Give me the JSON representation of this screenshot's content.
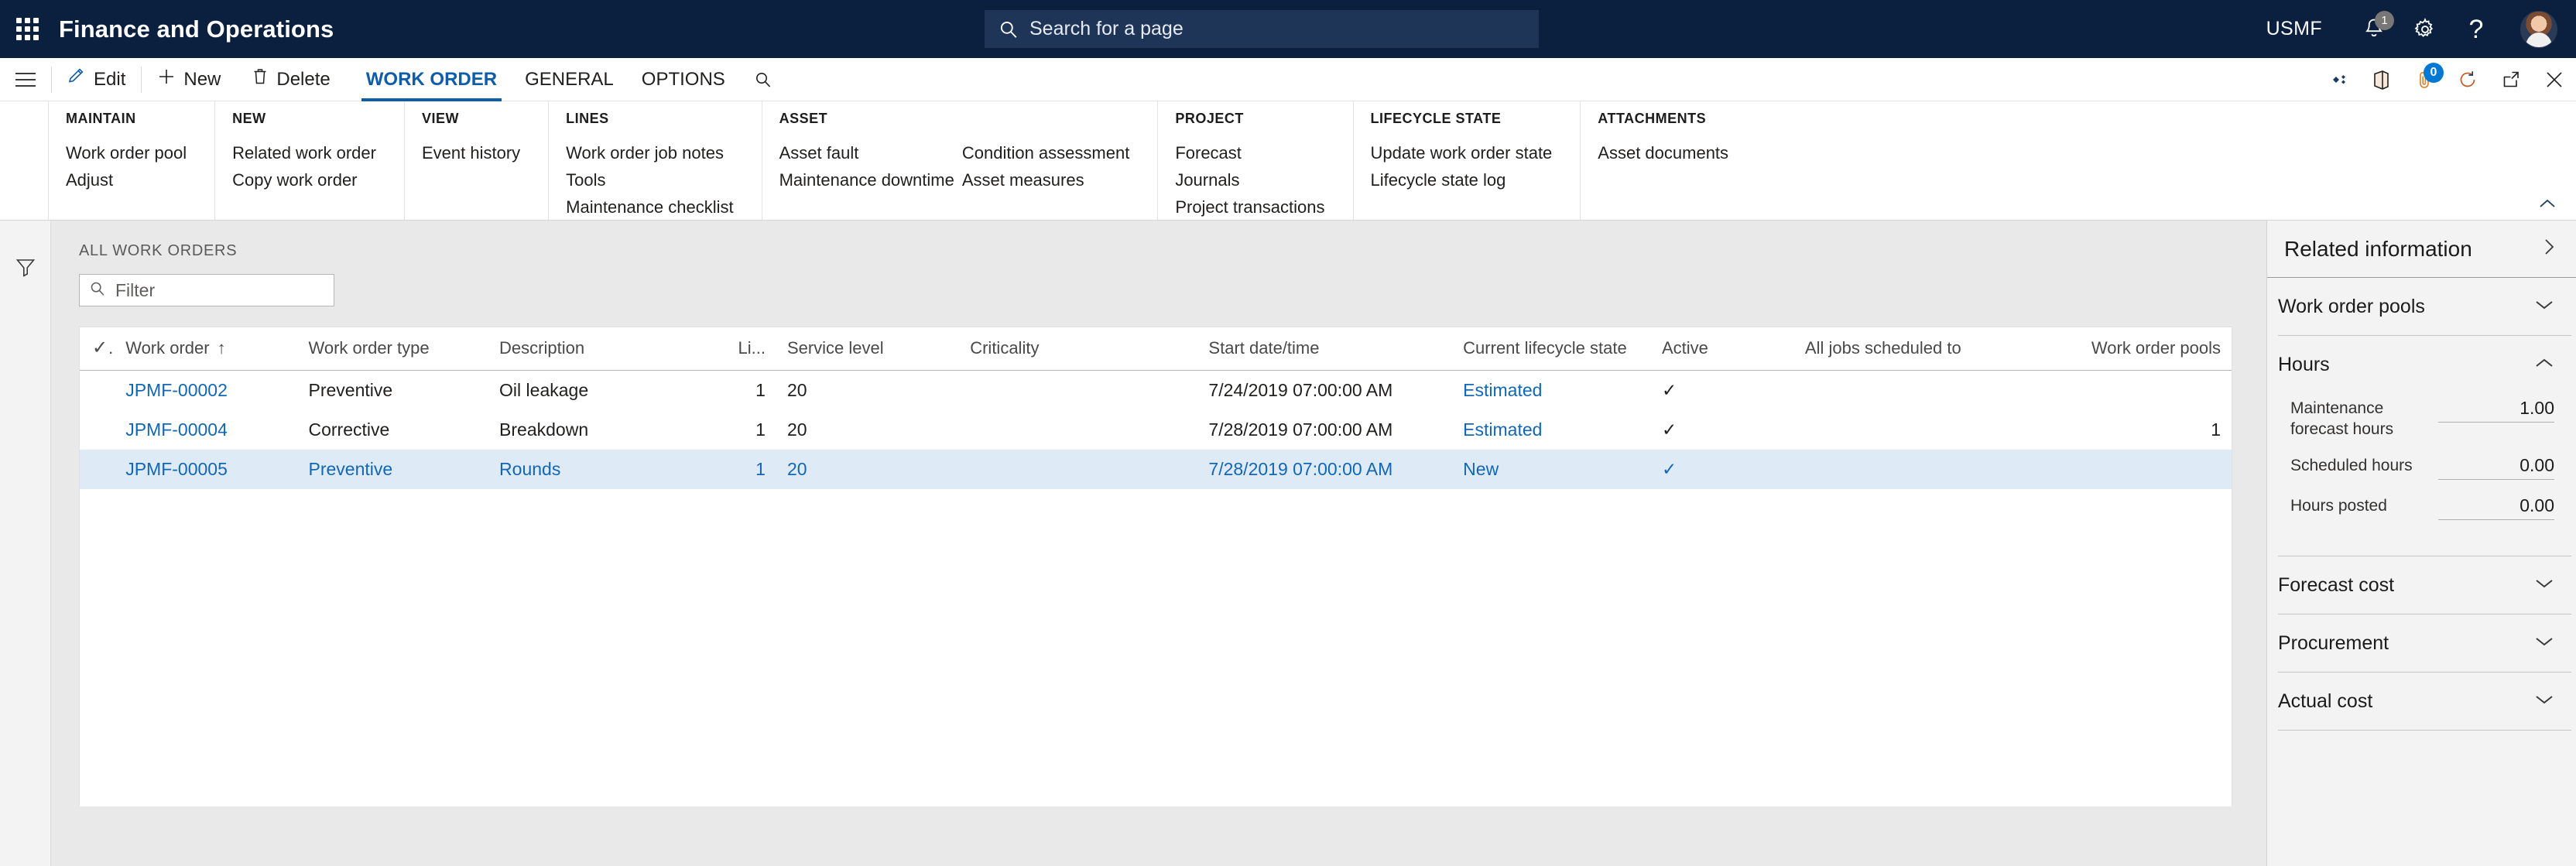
{
  "topbar": {
    "waffle_name": "app-launcher",
    "app_title": "Finance and Operations",
    "search_placeholder": "Search for a page",
    "company": "USMF",
    "notification_count": "1"
  },
  "commandbar": {
    "buttons": [
      {
        "label": "Edit",
        "icon": "pencil-icon"
      },
      {
        "label": "New",
        "icon": "plus-icon"
      },
      {
        "label": "Delete",
        "icon": "trash-icon"
      }
    ],
    "tabs": [
      {
        "label": "WORK ORDER",
        "active": true
      },
      {
        "label": "GENERAL",
        "active": false
      },
      {
        "label": "OPTIONS",
        "active": false
      }
    ],
    "attachment_count": "0"
  },
  "ribbon": {
    "groups": [
      {
        "title": "MAINTAIN",
        "columns": [
          {
            "items": [
              "Work order pool",
              "Adjust"
            ]
          }
        ]
      },
      {
        "title": "NEW",
        "columns": [
          {
            "items": [
              "Related work order",
              "Copy work order"
            ]
          }
        ]
      },
      {
        "title": "VIEW",
        "columns": [
          {
            "items": [
              "Event history"
            ]
          }
        ]
      },
      {
        "title": "LINES",
        "columns": [
          {
            "items": [
              "Work order job notes",
              "Tools",
              "Maintenance checklist"
            ]
          }
        ]
      },
      {
        "title": "ASSET",
        "columns": [
          {
            "items": [
              "Asset fault",
              "Maintenance downtime"
            ]
          },
          {
            "items": [
              "Condition assessment",
              "Asset measures"
            ]
          }
        ]
      },
      {
        "title": "PROJECT",
        "columns": [
          {
            "items": [
              "Forecast",
              "Journals",
              "Project transactions"
            ]
          }
        ]
      },
      {
        "title": "LIFECYCLE STATE",
        "columns": [
          {
            "items": [
              "Update work order state",
              "Lifecycle state log"
            ]
          }
        ]
      },
      {
        "title": "ATTACHMENTS",
        "columns": [
          {
            "items": [
              "Asset documents"
            ]
          }
        ]
      }
    ]
  },
  "list": {
    "caption": "ALL WORK ORDERS",
    "filter_placeholder": "Filter",
    "columns": [
      {
        "label": "",
        "key": "check"
      },
      {
        "label": "Work order",
        "key": "work_order",
        "sort": "↑"
      },
      {
        "label": "Work order type",
        "key": "work_order_type"
      },
      {
        "label": "Description",
        "key": "description"
      },
      {
        "label": "Li...",
        "key": "lines"
      },
      {
        "label": "Service level",
        "key": "service_level"
      },
      {
        "label": "Criticality",
        "key": "criticality"
      },
      {
        "label": "Start date/time",
        "key": "start_datetime"
      },
      {
        "label": "Current lifecycle state",
        "key": "lifecycle_state"
      },
      {
        "label": "Active",
        "key": "active"
      },
      {
        "label": "All jobs scheduled to",
        "key": "all_jobs_scheduled_to"
      },
      {
        "label": "Work order pools",
        "key": "work_order_pools"
      }
    ],
    "rows": [
      {
        "work_order": "JPMF-00002",
        "work_order_type": "Preventive",
        "description": "Oil leakage",
        "lines": "1",
        "service_level": "20",
        "criticality": "",
        "start_datetime": "7/24/2019 07:00:00 AM",
        "lifecycle_state": "Estimated",
        "active": "✓",
        "all_jobs_scheduled_to": "",
        "work_order_pools": "",
        "selected": false
      },
      {
        "work_order": "JPMF-00004",
        "work_order_type": "Corrective",
        "description": "Breakdown",
        "lines": "1",
        "service_level": "20",
        "criticality": "",
        "start_datetime": "7/28/2019 07:00:00 AM",
        "lifecycle_state": "Estimated",
        "active": "✓",
        "all_jobs_scheduled_to": "",
        "work_order_pools": "1",
        "selected": false
      },
      {
        "work_order": "JPMF-00005",
        "work_order_type": "Preventive",
        "description": "Rounds",
        "lines": "1",
        "service_level": "20",
        "criticality": "",
        "start_datetime": "7/28/2019 07:00:00 AM",
        "lifecycle_state": "New",
        "active": "✓",
        "all_jobs_scheduled_to": "",
        "work_order_pools": "",
        "selected": true
      }
    ]
  },
  "right_pane": {
    "title": "Related information",
    "sections": [
      {
        "title": "Work order pools",
        "expanded": false,
        "fields": []
      },
      {
        "title": "Hours",
        "expanded": true,
        "fields": [
          {
            "label": "Maintenance forecast hours",
            "value": "1.00"
          },
          {
            "label": "Scheduled hours",
            "value": "0.00"
          },
          {
            "label": "Hours posted",
            "value": "0.00"
          }
        ]
      },
      {
        "title": "Forecast cost",
        "expanded": false,
        "fields": []
      },
      {
        "title": "Procurement",
        "expanded": false,
        "fields": []
      },
      {
        "title": "Actual cost",
        "expanded": false,
        "fields": []
      }
    ]
  },
  "colors": {
    "brand_navy": "#0b1f3f",
    "accent_blue": "#0f5ca8",
    "link_blue": "#1267b5",
    "selected_row": "#deebf7",
    "badge_blue": "#0078d4"
  }
}
